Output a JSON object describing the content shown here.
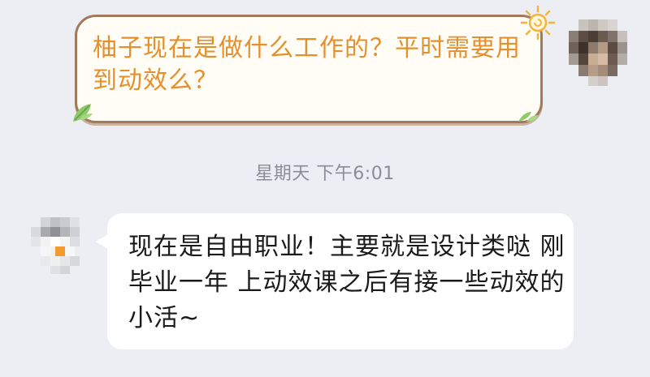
{
  "chat": {
    "outgoing_message": "柚子现在是做什么工作的？平时需要用到动效么？",
    "timestamp": "星期天 下午6:01",
    "incoming_message": "现在是自由职业！主要就是设计类哒 刚毕业一年 上动效课之后有接一些动效的小活~"
  },
  "icons": {
    "sun": "sun-icon",
    "leaf": "leaf-icon"
  },
  "colors": {
    "background": "#eceef3",
    "outgoing_text": "#e4902e",
    "outgoing_border": "#a2795a",
    "incoming_bubble": "#ffffff"
  }
}
